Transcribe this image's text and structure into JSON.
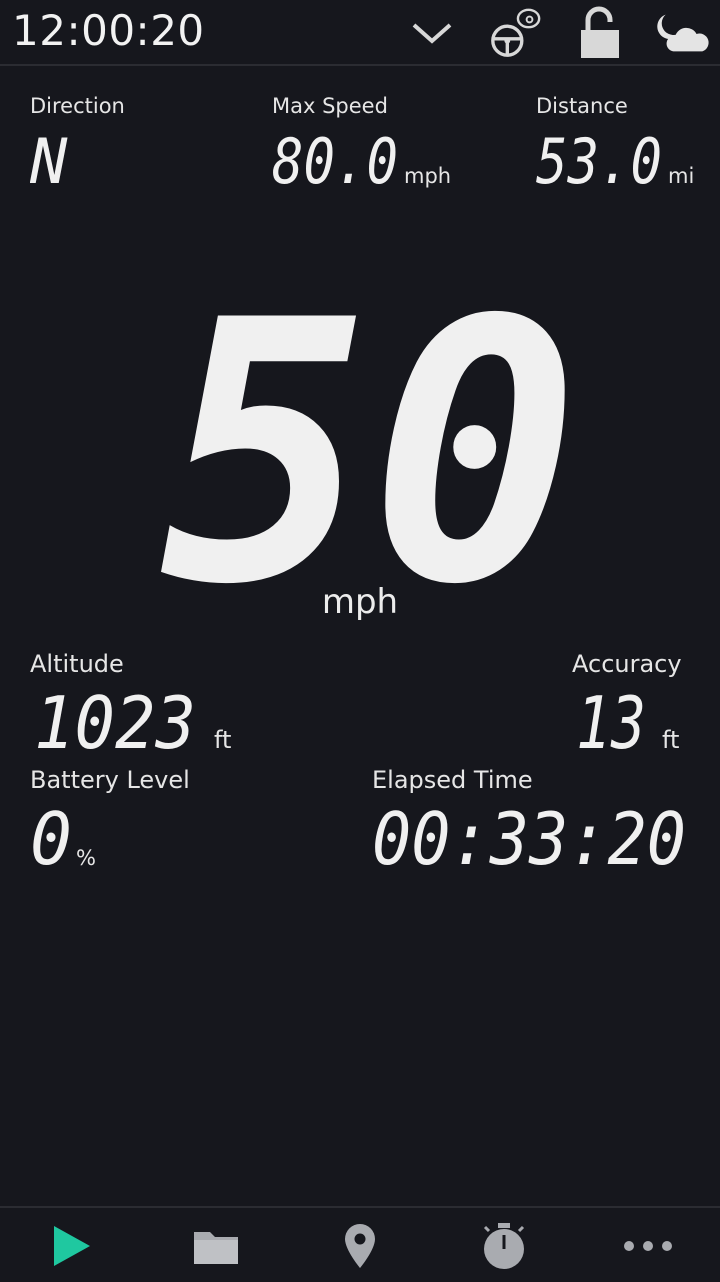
{
  "status_bar": {
    "clock": "12:00:20",
    "icons": [
      "chevron-down-icon",
      "steering-wheel-icon",
      "lock-open-icon",
      "night-weather-icon"
    ]
  },
  "stats": {
    "direction": {
      "label": "Direction",
      "value": "N"
    },
    "max_speed": {
      "label": "Max Speed",
      "value": "80.0",
      "unit": "mph"
    },
    "distance": {
      "label": "Distance",
      "value": "53.0",
      "unit": "mi"
    },
    "speed": {
      "value": "50",
      "unit": "mph"
    },
    "altitude": {
      "label": "Altitude",
      "value": "1023",
      "unit": "ft"
    },
    "accuracy": {
      "label": "Accuracy",
      "value": "13",
      "unit": "ft"
    },
    "battery": {
      "label": "Battery Level",
      "value": "0",
      "unit": "%"
    },
    "elapsed": {
      "label": "Elapsed Time",
      "value": "00:33:20"
    }
  },
  "bottom_nav": {
    "items": [
      "play-icon",
      "folder-icon",
      "location-pin-icon",
      "stopwatch-icon",
      "more-icon"
    ]
  },
  "colors": {
    "background": "#16171d",
    "lcd_text": "#f0f0f0",
    "accent": "#1fc8a0",
    "icon_gray": "#a9abb0"
  }
}
